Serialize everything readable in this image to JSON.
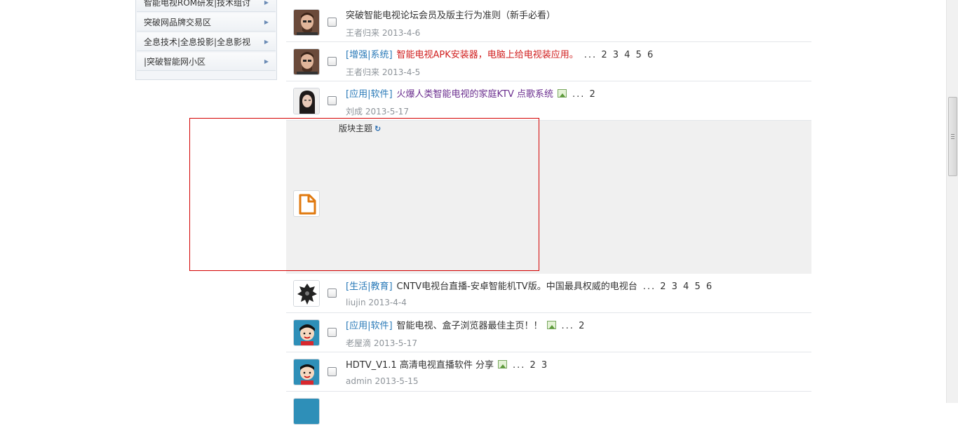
{
  "sidebar": {
    "items": [
      {
        "label": "智能电视ROM研发|技术组讨"
      },
      {
        "label": "突破网品牌交易区"
      },
      {
        "label": "全息技术|全息投影|全息影视"
      },
      {
        "label": "|突破智能网小区"
      }
    ]
  },
  "threads_top": [
    {
      "category": "",
      "title": "突破智能电视论坛会员及版主行为准则（新手必看）",
      "author": "王者归来",
      "date": "2013-4-6",
      "pages": "",
      "has_image": false,
      "avatar": "man-avatar"
    },
    {
      "category": "[增强|系统]",
      "title": "智能电视APK安装器，电脑上给电视装应用。",
      "author": "王者归来",
      "date": "2013-4-5",
      "pages": "... 2 3 4 5 6",
      "has_image": false,
      "avatar": "man-avatar"
    },
    {
      "category": "[应用|软件]",
      "title": "火爆人类智能电视的家庭KTV 点歌系统",
      "author": "刘成",
      "date": "2013-5-17",
      "pages": "... 2",
      "has_image": true,
      "avatar": "woman-avatar"
    }
  ],
  "panel": {
    "title": "版块主题",
    "refresh_icon": "refresh-icon"
  },
  "threads_bottom": [
    {
      "category": "[生活|教育]",
      "title": "CNTV电视台直播-安卓智能机TV版。中国最具权威的电视台",
      "author": "liujin",
      "date": "2013-4-4",
      "pages": "... 2 3 4 5 6",
      "has_image": false,
      "avatar": "robot-avatar"
    },
    {
      "category": "[应用|软件]",
      "title": "智能电视、盒子浏览器最佳主页！！",
      "author": "老屋滴",
      "date": "2013-5-17",
      "pages": "... 2",
      "has_image": true,
      "avatar": "cartoon-avatar"
    },
    {
      "category": "",
      "title": "HDTV_V1.1 高清电视直播软件 分享",
      "author": "admin",
      "date": "2013-5-15",
      "pages": "... 2 3",
      "has_image": true,
      "avatar": "cartoon-avatar"
    }
  ],
  "colors": {
    "category": "#2a7ab8",
    "highlight_red": "#d12020",
    "highlight_purple": "#6b2f8f",
    "selection_box": "#d40000"
  }
}
